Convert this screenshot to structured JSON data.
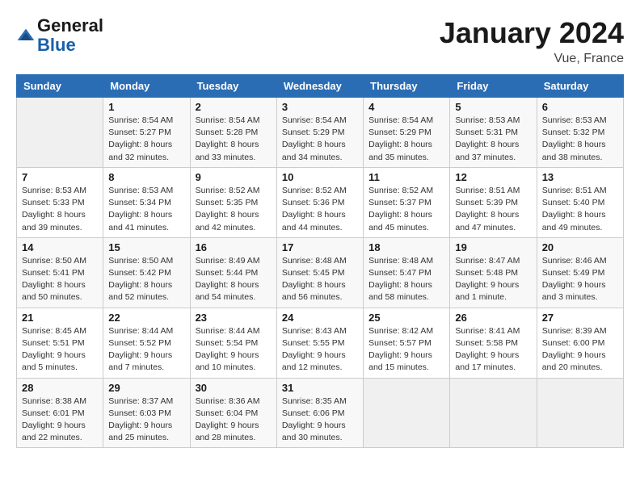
{
  "header": {
    "logo_line1": "General",
    "logo_line2": "Blue",
    "month": "January 2024",
    "location": "Vue, France"
  },
  "columns": [
    "Sunday",
    "Monday",
    "Tuesday",
    "Wednesday",
    "Thursday",
    "Friday",
    "Saturday"
  ],
  "weeks": [
    [
      {
        "day": "",
        "info": ""
      },
      {
        "day": "1",
        "info": "Sunrise: 8:54 AM\nSunset: 5:27 PM\nDaylight: 8 hours\nand 32 minutes."
      },
      {
        "day": "2",
        "info": "Sunrise: 8:54 AM\nSunset: 5:28 PM\nDaylight: 8 hours\nand 33 minutes."
      },
      {
        "day": "3",
        "info": "Sunrise: 8:54 AM\nSunset: 5:29 PM\nDaylight: 8 hours\nand 34 minutes."
      },
      {
        "day": "4",
        "info": "Sunrise: 8:54 AM\nSunset: 5:29 PM\nDaylight: 8 hours\nand 35 minutes."
      },
      {
        "day": "5",
        "info": "Sunrise: 8:53 AM\nSunset: 5:31 PM\nDaylight: 8 hours\nand 37 minutes."
      },
      {
        "day": "6",
        "info": "Sunrise: 8:53 AM\nSunset: 5:32 PM\nDaylight: 8 hours\nand 38 minutes."
      }
    ],
    [
      {
        "day": "7",
        "info": "Sunrise: 8:53 AM\nSunset: 5:33 PM\nDaylight: 8 hours\nand 39 minutes."
      },
      {
        "day": "8",
        "info": "Sunrise: 8:53 AM\nSunset: 5:34 PM\nDaylight: 8 hours\nand 41 minutes."
      },
      {
        "day": "9",
        "info": "Sunrise: 8:52 AM\nSunset: 5:35 PM\nDaylight: 8 hours\nand 42 minutes."
      },
      {
        "day": "10",
        "info": "Sunrise: 8:52 AM\nSunset: 5:36 PM\nDaylight: 8 hours\nand 44 minutes."
      },
      {
        "day": "11",
        "info": "Sunrise: 8:52 AM\nSunset: 5:37 PM\nDaylight: 8 hours\nand 45 minutes."
      },
      {
        "day": "12",
        "info": "Sunrise: 8:51 AM\nSunset: 5:39 PM\nDaylight: 8 hours\nand 47 minutes."
      },
      {
        "day": "13",
        "info": "Sunrise: 8:51 AM\nSunset: 5:40 PM\nDaylight: 8 hours\nand 49 minutes."
      }
    ],
    [
      {
        "day": "14",
        "info": "Sunrise: 8:50 AM\nSunset: 5:41 PM\nDaylight: 8 hours\nand 50 minutes."
      },
      {
        "day": "15",
        "info": "Sunrise: 8:50 AM\nSunset: 5:42 PM\nDaylight: 8 hours\nand 52 minutes."
      },
      {
        "day": "16",
        "info": "Sunrise: 8:49 AM\nSunset: 5:44 PM\nDaylight: 8 hours\nand 54 minutes."
      },
      {
        "day": "17",
        "info": "Sunrise: 8:48 AM\nSunset: 5:45 PM\nDaylight: 8 hours\nand 56 minutes."
      },
      {
        "day": "18",
        "info": "Sunrise: 8:48 AM\nSunset: 5:47 PM\nDaylight: 8 hours\nand 58 minutes."
      },
      {
        "day": "19",
        "info": "Sunrise: 8:47 AM\nSunset: 5:48 PM\nDaylight: 9 hours\nand 1 minute."
      },
      {
        "day": "20",
        "info": "Sunrise: 8:46 AM\nSunset: 5:49 PM\nDaylight: 9 hours\nand 3 minutes."
      }
    ],
    [
      {
        "day": "21",
        "info": "Sunrise: 8:45 AM\nSunset: 5:51 PM\nDaylight: 9 hours\nand 5 minutes."
      },
      {
        "day": "22",
        "info": "Sunrise: 8:44 AM\nSunset: 5:52 PM\nDaylight: 9 hours\nand 7 minutes."
      },
      {
        "day": "23",
        "info": "Sunrise: 8:44 AM\nSunset: 5:54 PM\nDaylight: 9 hours\nand 10 minutes."
      },
      {
        "day": "24",
        "info": "Sunrise: 8:43 AM\nSunset: 5:55 PM\nDaylight: 9 hours\nand 12 minutes."
      },
      {
        "day": "25",
        "info": "Sunrise: 8:42 AM\nSunset: 5:57 PM\nDaylight: 9 hours\nand 15 minutes."
      },
      {
        "day": "26",
        "info": "Sunrise: 8:41 AM\nSunset: 5:58 PM\nDaylight: 9 hours\nand 17 minutes."
      },
      {
        "day": "27",
        "info": "Sunrise: 8:39 AM\nSunset: 6:00 PM\nDaylight: 9 hours\nand 20 minutes."
      }
    ],
    [
      {
        "day": "28",
        "info": "Sunrise: 8:38 AM\nSunset: 6:01 PM\nDaylight: 9 hours\nand 22 minutes."
      },
      {
        "day": "29",
        "info": "Sunrise: 8:37 AM\nSunset: 6:03 PM\nDaylight: 9 hours\nand 25 minutes."
      },
      {
        "day": "30",
        "info": "Sunrise: 8:36 AM\nSunset: 6:04 PM\nDaylight: 9 hours\nand 28 minutes."
      },
      {
        "day": "31",
        "info": "Sunrise: 8:35 AM\nSunset: 6:06 PM\nDaylight: 9 hours\nand 30 minutes."
      },
      {
        "day": "",
        "info": ""
      },
      {
        "day": "",
        "info": ""
      },
      {
        "day": "",
        "info": ""
      }
    ]
  ]
}
